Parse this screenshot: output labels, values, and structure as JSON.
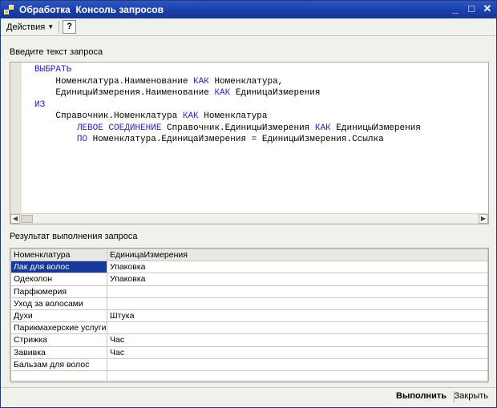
{
  "window": {
    "title": "Обработка  Консоль запросов"
  },
  "toolbar": {
    "actions_label": "Действия",
    "help_label": "?"
  },
  "query_section": {
    "label": "Введите текст запроса",
    "lines": [
      [
        {
          "t": "ВЫБРАТЬ",
          "k": true
        }
      ],
      [
        {
          "t": "    Номенклатура.Наименование ",
          "k": false
        },
        {
          "t": "КАК",
          "k": true
        },
        {
          "t": " Номенклатура,",
          "k": false
        }
      ],
      [
        {
          "t": "    ЕдиницыИзмерения.Наименование ",
          "k": false
        },
        {
          "t": "КАК",
          "k": true
        },
        {
          "t": " ЕдиницаИзмерения",
          "k": false
        }
      ],
      [
        {
          "t": "ИЗ",
          "k": true
        }
      ],
      [
        {
          "t": "    Справочник.Номенклатура ",
          "k": false
        },
        {
          "t": "КАК",
          "k": true
        },
        {
          "t": " Номенклатура",
          "k": false
        }
      ],
      [
        {
          "t": "        ",
          "k": false
        },
        {
          "t": "ЛЕВОЕ СОЕДИНЕНИЕ",
          "k": true
        },
        {
          "t": " Справочник.ЕдиницыИзмерения ",
          "k": false
        },
        {
          "t": "КАК",
          "k": true
        },
        {
          "t": " ЕдиницыИзмерения",
          "k": false
        }
      ],
      [
        {
          "t": "        ",
          "k": false
        },
        {
          "t": "ПО",
          "k": true
        },
        {
          "t": " Номенклатура.ЕдиницаИзмерения = ЕдиницыИзмерения.Ссылка",
          "k": false
        }
      ]
    ]
  },
  "result_section": {
    "label": "Результат выполнения запроса",
    "columns": [
      "Номенклатура",
      "ЕдиницаИзмерения"
    ],
    "rows": [
      [
        "Лак для волос",
        "Упаковка"
      ],
      [
        "Одеколон",
        "Упаковка"
      ],
      [
        "Парфюмерия",
        ""
      ],
      [
        "Уход за волосами",
        ""
      ],
      [
        "Духи",
        "Штука"
      ],
      [
        "Парикмахерские услуги",
        ""
      ],
      [
        "Стрижка",
        "Час"
      ],
      [
        "Завивка",
        "Час"
      ],
      [
        "Бальзам для волос",
        ""
      ],
      [
        "",
        ""
      ]
    ],
    "selected_row": 0
  },
  "footer": {
    "run_label": "Выполнить",
    "close_label": "Закрыть"
  },
  "colors": {
    "keyword": "#1c1cf0",
    "titlebar": "#1a3ea8",
    "selection": "#16399a"
  }
}
